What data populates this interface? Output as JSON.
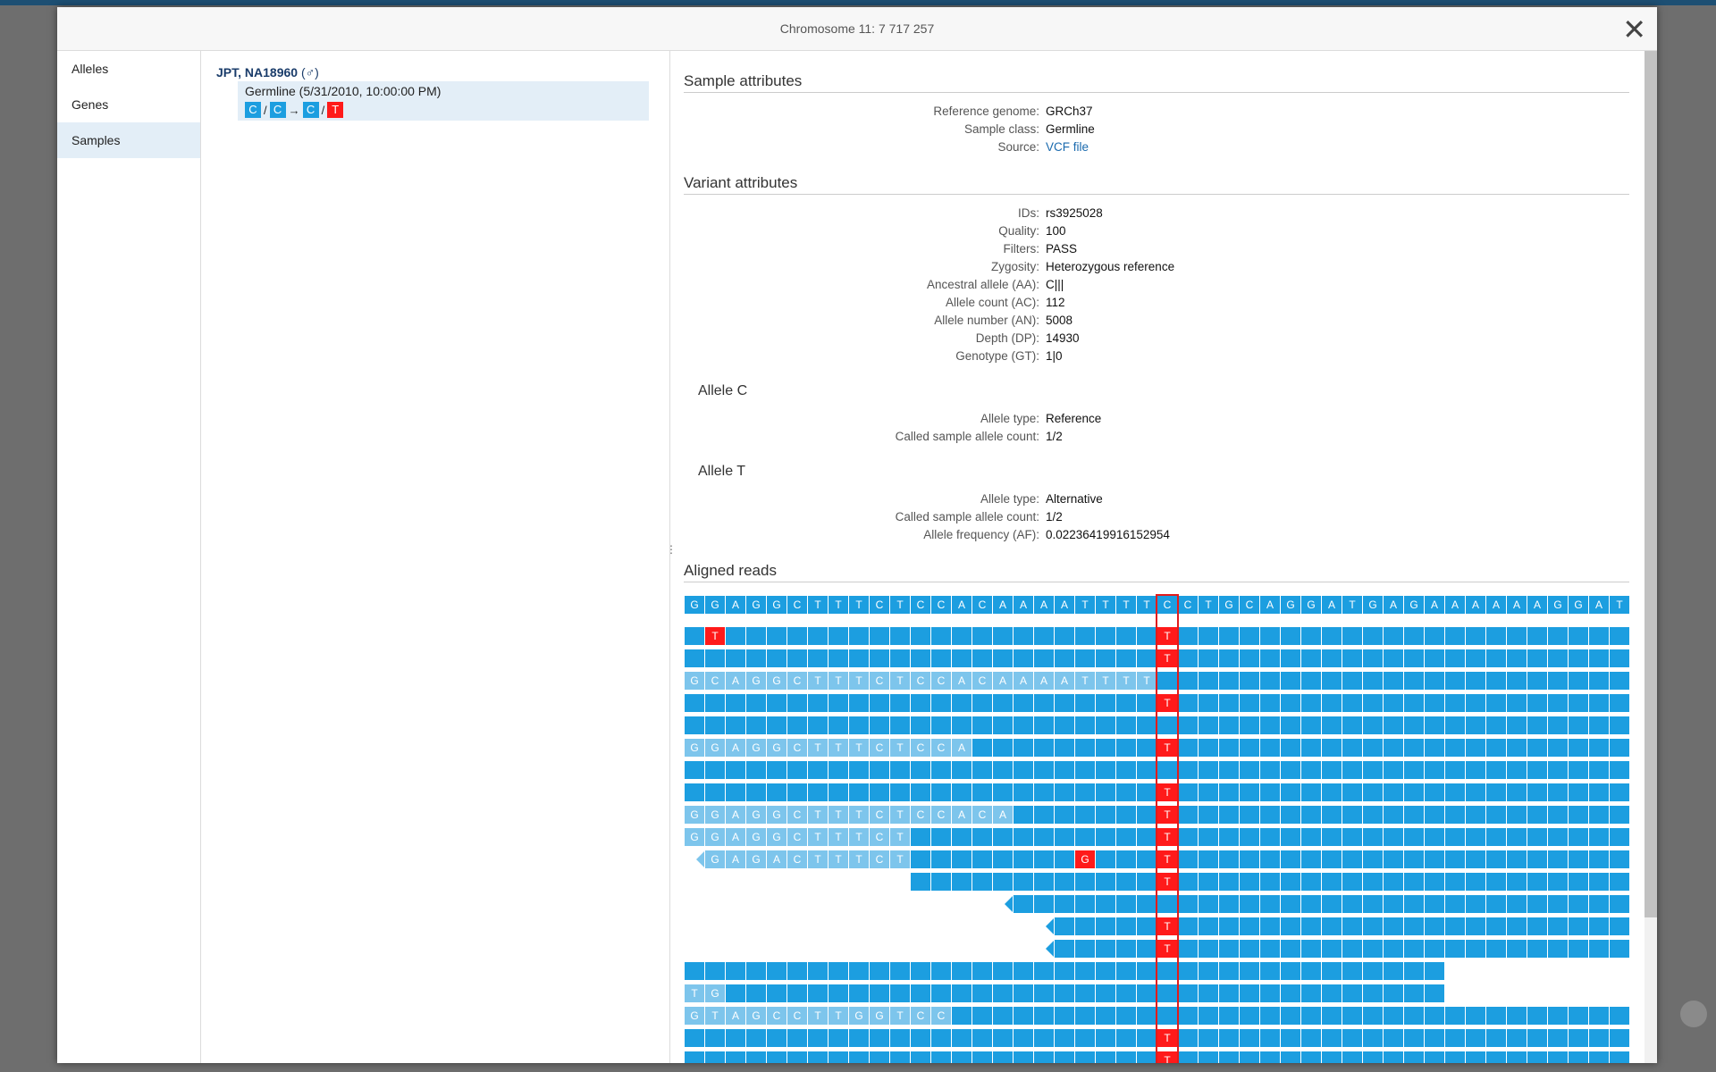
{
  "window": {
    "title": "Chromosome 11: 7 717 257",
    "close_label": "✕"
  },
  "nav": {
    "items": [
      {
        "label": "Alleles",
        "active": false
      },
      {
        "label": "Genes",
        "active": false
      },
      {
        "label": "Samples",
        "active": true
      }
    ]
  },
  "sample": {
    "name": "JPT, NA18960",
    "sex_symbol": "(♂)",
    "row_label": "Germline (5/31/2010, 10:00:00 PM)",
    "genotype": {
      "ref1": "C",
      "ref2": "C",
      "arrow": "→",
      "alt1": "C",
      "alt2": "T",
      "sep": "/"
    }
  },
  "sample_attributes": {
    "heading": "Sample attributes",
    "rows": [
      {
        "label": "Reference genome:",
        "value": "GRCh37"
      },
      {
        "label": "Sample class:",
        "value": "Germline"
      },
      {
        "label": "Source:",
        "value": "VCF file"
      }
    ]
  },
  "variant_attributes": {
    "heading": "Variant attributes",
    "rows": [
      {
        "label": "IDs:",
        "value": "rs3925028"
      },
      {
        "label": "Quality:",
        "value": "100"
      },
      {
        "label": "Filters:",
        "value": "PASS"
      },
      {
        "label": "Zygosity:",
        "value": "Heterozygous reference"
      },
      {
        "label": "Ancestral allele (AA):",
        "value": "C|||"
      },
      {
        "label": "Allele count (AC):",
        "value": "112"
      },
      {
        "label": "Allele number (AN):",
        "value": "5008"
      },
      {
        "label": "Depth (DP):",
        "value": "14930"
      },
      {
        "label": "Genotype (GT):",
        "value": "1|0"
      }
    ]
  },
  "allele_c": {
    "heading": "Allele C",
    "rows": [
      {
        "label": "Allele type:",
        "value": "Reference"
      },
      {
        "label": "Called sample allele count:",
        "value": "1/2"
      }
    ]
  },
  "allele_t": {
    "heading": "Allele T",
    "rows": [
      {
        "label": "Allele type:",
        "value": "Alternative"
      },
      {
        "label": "Called sample allele count:",
        "value": "1/2"
      },
      {
        "label": "Allele frequency (AF):",
        "value": "0.02236419916152954"
      }
    ]
  },
  "aligned_reads": {
    "heading": "Aligned reads",
    "reference": "GGAGGCTTTCTCCACAAAATTTTCCTGCAGGATGAGAAAAAAGGAT",
    "variant_index": 23,
    "reads": [
      {
        "start": 0,
        "end": 46,
        "soft": "",
        "mism": {
          "1": "T",
          "23": "T"
        }
      },
      {
        "start": 0,
        "end": 46,
        "soft": "",
        "mism": {
          "23": "T"
        }
      },
      {
        "start": 0,
        "end": 46,
        "soft": "GCAGGCTTTCTCCACAAAATTTT",
        "mism": {}
      },
      {
        "start": 0,
        "end": 46,
        "soft": "",
        "mism": {
          "23": "T"
        }
      },
      {
        "start": 0,
        "end": 46,
        "soft": "",
        "mism": {}
      },
      {
        "start": 0,
        "end": 46,
        "soft": "GGAGGCTTTCTCCA",
        "mism": {
          "23": "T"
        }
      },
      {
        "start": 0,
        "end": 46,
        "soft": "",
        "mism": {}
      },
      {
        "start": 0,
        "end": 46,
        "soft": "",
        "mism": {
          "23": "T"
        }
      },
      {
        "start": 0,
        "end": 46,
        "soft": "GGAGGCTTTCTCCACA",
        "mism": {
          "23": "T"
        }
      },
      {
        "start": 0,
        "end": 46,
        "soft": "GGAGGCTTTCT",
        "mism": {
          "23": "T"
        }
      },
      {
        "start": 1,
        "end": 46,
        "soft": "GAGACTTTCT",
        "mism": {
          "19": "G",
          "23": "T"
        },
        "arrow": true,
        "arrow_light": true
      },
      {
        "start": 11,
        "end": 46,
        "soft": "",
        "mism": {
          "23": "T"
        }
      },
      {
        "start": 16,
        "end": 46,
        "soft": "",
        "mism": {},
        "arrow": true
      },
      {
        "start": 18,
        "end": 46,
        "soft": "",
        "mism": {
          "23": "T"
        },
        "arrow": true
      },
      {
        "start": 18,
        "end": 46,
        "soft": "",
        "mism": {
          "23": "T"
        },
        "arrow": true
      },
      {
        "start": 0,
        "end": 37,
        "soft": "",
        "mism": {}
      },
      {
        "start": 0,
        "end": 37,
        "soft": "TG",
        "mism": {}
      },
      {
        "start": 0,
        "end": 46,
        "soft": "GTAGCCTTGGTCC",
        "mism": {}
      },
      {
        "start": 0,
        "end": 46,
        "soft": "",
        "mism": {
          "23": "T"
        }
      },
      {
        "start": 0,
        "end": 46,
        "soft": "",
        "mism": {
          "23": "T"
        }
      }
    ]
  },
  "colors": {
    "base": "#1c9ee0",
    "soft_clip": "#7dc5ec",
    "variant": "#ff1a1a"
  }
}
